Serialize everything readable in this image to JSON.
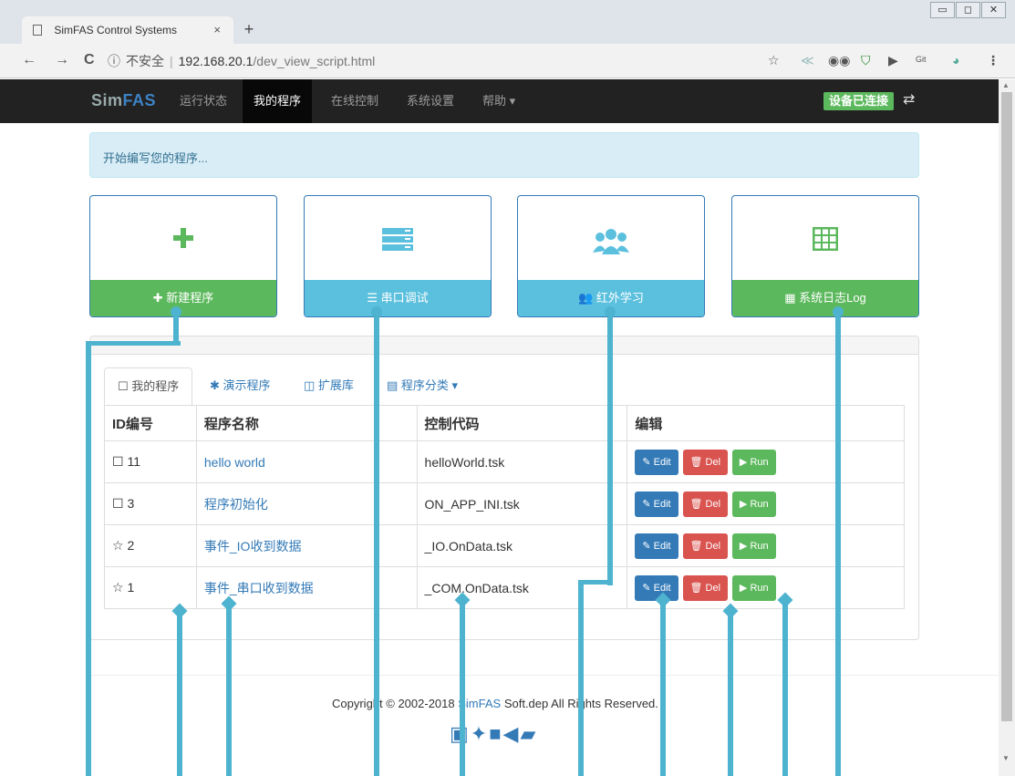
{
  "browser": {
    "tab_title": "SimFAS Control Systems",
    "tab_close": "×",
    "new_tab": "+",
    "window_buttons": [
      "▭",
      "◻",
      "✕"
    ],
    "back": "←",
    "forward": "→",
    "reload": "C",
    "info_icon": "ⓘ",
    "security_text": "不安全",
    "url_host": "192.168.20.1",
    "url_path": "/dev_view_script.html",
    "star": "☆",
    "menu": "⋮"
  },
  "navbar": {
    "brand_prefix": "Sim",
    "brand_suffix": "FAS",
    "items": [
      {
        "label": "运行状态"
      },
      {
        "label": "我的程序"
      },
      {
        "label": "在线控制"
      },
      {
        "label": "系统设置"
      },
      {
        "label": "帮助 ▾"
      }
    ],
    "status_badge": "设备已连接",
    "status_icon": "⇄"
  },
  "alert": {
    "text": "开始编写您的程序..."
  },
  "cards": [
    {
      "label": "✚ 新建程序",
      "icon": "plus-icon",
      "color": "#5cb85c"
    },
    {
      "label": "☰ 串口调试",
      "icon": "server-icon",
      "color": "#5bc0de"
    },
    {
      "label": "👥 红外学习",
      "icon": "users-icon",
      "color": "#5bc0de"
    },
    {
      "label": "▦ 系统日志Log",
      "icon": "table-icon",
      "color": "#5cb85c"
    }
  ],
  "tabs": [
    {
      "label": "☐ 我的程序"
    },
    {
      "label": "✱ 演示程序"
    },
    {
      "label": "◫ 扩展库"
    },
    {
      "label": "▤ 程序分类 ▾"
    }
  ],
  "table": {
    "headers": [
      "ID编号",
      "程序名称",
      "控制代码",
      "编辑"
    ],
    "rows": [
      {
        "id": "☐ 11",
        "name": "hello world",
        "code": "helloWorld.tsk"
      },
      {
        "id": "☐ 3",
        "name": "程序初始化",
        "code": "ON_APP_INI.tsk"
      },
      {
        "id": "☆ 2",
        "name": "事件_IO收到数据",
        "code": "_IO.OnData.tsk"
      },
      {
        "id": "☆ 1",
        "name": "事件_串口收到数据",
        "code": "_COM.OnData.tsk"
      }
    ],
    "edit_label": "✎ Edit",
    "del_label": "🗑 Del",
    "run_label": "▶ Run"
  },
  "footer": {
    "copyright_pre": "Copyright © 2002-2018 ",
    "copyright_brand": "SimFAS",
    "copyright_post": " Soft.dep All Rights Reserved.",
    "social_icons": [
      "facebook-icon",
      "twitter-icon",
      "video-icon",
      "book-icon"
    ]
  },
  "colors": {
    "brand_blue": "#337ab7",
    "success": "#5cb85c",
    "info": "#5bc0de",
    "danger": "#d9534f",
    "annotation": "#4db3cf"
  }
}
